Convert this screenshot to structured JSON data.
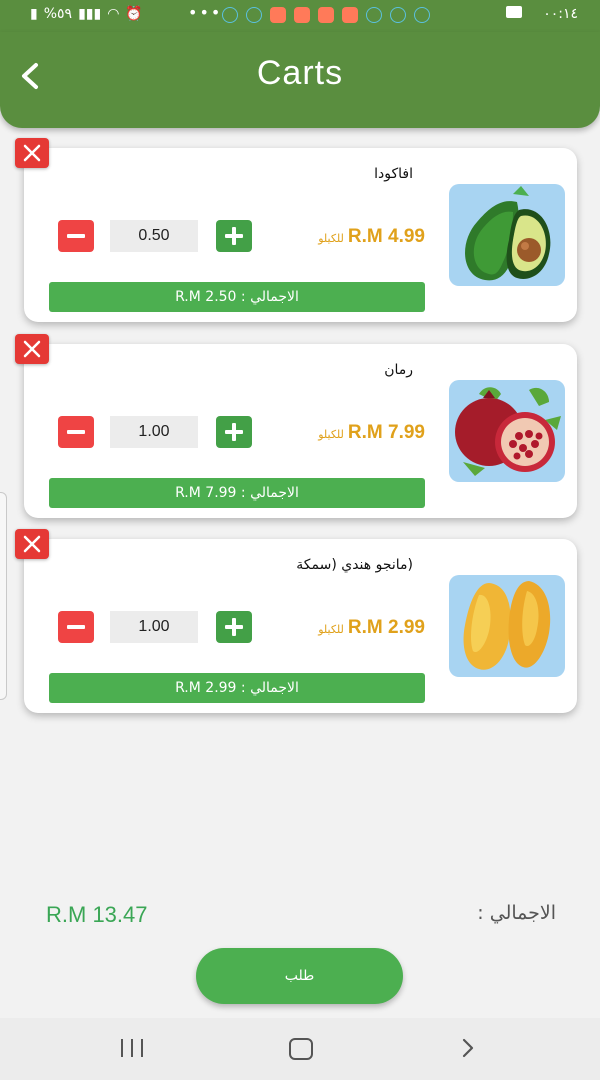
{
  "status_bar": {
    "battery": "%٥٩",
    "time": "٠٠:١٤"
  },
  "app_bar": {
    "title": "Carts"
  },
  "cart": {
    "items": [
      {
        "name": "افاكودا",
        "price": "R.M 4.99",
        "unit": "للكيلو",
        "quantity": "0.50",
        "total": "الاجمالي : R.M 2.50",
        "image": "avocado"
      },
      {
        "name": "رمان",
        "price": "R.M 7.99",
        "unit": "للكيلو",
        "quantity": "1.00",
        "total": "الاجمالي : R.M 7.99",
        "image": "pomegranate"
      },
      {
        "name": "(مانجو هندي (سمكة",
        "price": "R.M 2.99",
        "unit": "للكيلو",
        "quantity": "1.00",
        "total": "الاجمالي : R.M 2.99",
        "image": "mango"
      }
    ]
  },
  "footer": {
    "total_label": "الاجمالي :",
    "total_value": "R.M 13.47",
    "order_label": "طلب"
  },
  "colors": {
    "primary_green": "#5a8e3f",
    "button_green": "#4caf50",
    "price_gold": "#e0a11b",
    "remove_red": "#e53935"
  }
}
